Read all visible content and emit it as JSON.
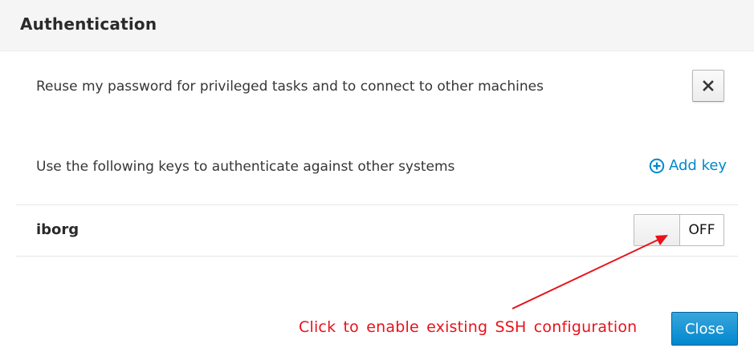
{
  "dialog": {
    "title": "Authentication",
    "reuse_password_text": "Reuse my password for privileged tasks and to connect to other machines",
    "keys_text": "Use the following keys to authenticate against other systems",
    "add_key_label": "Add key",
    "keys": [
      {
        "name": "iborg",
        "toggle_state": "OFF"
      }
    ],
    "close_label": "Close"
  },
  "annotation": {
    "text": "Click to enable existing SSH configuration",
    "color": "#e8121a"
  },
  "icons": {
    "remove": "close-icon",
    "add": "plus-circle-icon"
  },
  "colors": {
    "accent": "#0088ce",
    "header_bg": "#f5f5f5"
  }
}
